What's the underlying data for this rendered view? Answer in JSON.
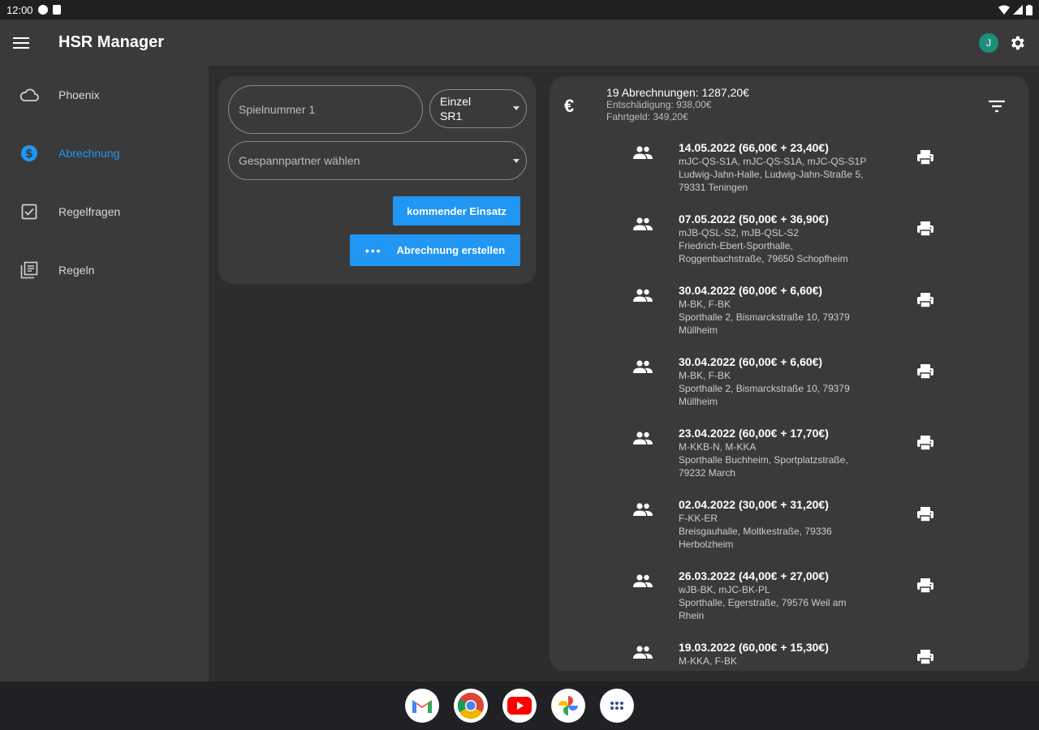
{
  "status": {
    "time": "12:00"
  },
  "appbar": {
    "title": "HSR Manager",
    "avatar_letter": "J"
  },
  "sidebar": {
    "items": [
      {
        "label": "Phoenix",
        "icon": "cloud-icon"
      },
      {
        "label": "Abrechnung",
        "icon": "dollar-icon"
      },
      {
        "label": "Regelfragen",
        "icon": "checkbox-icon"
      },
      {
        "label": "Regeln",
        "icon": "library-icon"
      }
    ]
  },
  "form": {
    "spielnummer_placeholder": "Spielnummer 1",
    "einzel_line1": "Einzel",
    "einzel_line2": "SR1",
    "gespann_placeholder": "Gespannpartner wählen",
    "kommend_label": "kommender Einsatz",
    "erstellen_dots": "•••",
    "erstellen_label": "Abrechnung erstellen"
  },
  "summary": {
    "title": "19 Abrechnungen: 1287,20€",
    "entschaedigung": "Entschädigung: 938,00€",
    "fahrtgeld": "Fahrtgeld: 349,20€"
  },
  "entries": [
    {
      "title": "14.05.2022 (66,00€ + 23,40€)",
      "lines": [
        "mJC-QS-S1A, mJC-QS-S1A, mJC-QS-S1P",
        "Ludwig-Jahn-Halle, Ludwig-Jahn-Straße 5,",
        "79331 Teningen"
      ]
    },
    {
      "title": "07.05.2022 (50,00€ + 36,90€)",
      "lines": [
        "mJB-QSL-S2, mJB-QSL-S2",
        "Friedrich-Ebert-Sporthalle,",
        "Roggenbachstraße, 79650 Schopfheim"
      ]
    },
    {
      "title": "30.04.2022 (60,00€ + 6,60€)",
      "lines": [
        "M-BK, F-BK",
        "Sporthalle 2, Bismarckstraße 10, 79379",
        "Müllheim"
      ]
    },
    {
      "title": "30.04.2022 (60,00€ + 6,60€)",
      "lines": [
        "M-BK, F-BK",
        "Sporthalle 2, Bismarckstraße 10, 79379",
        "Müllheim"
      ]
    },
    {
      "title": "23.04.2022 (60,00€ + 17,70€)",
      "lines": [
        "M-KKB-N, M-KKA",
        "Sporthalle Buchheim, Sportplatzstraße,",
        "79232 March"
      ]
    },
    {
      "title": "02.04.2022 (30,00€ + 31,20€)",
      "lines": [
        "F-KK-ER",
        "Breisgauhalle, Moltkestraße, 79336",
        "Herbolzheim"
      ]
    },
    {
      "title": "26.03.2022 (44,00€ + 27,00€)",
      "lines": [
        "wJB-BK, mJC-BK-PL",
        "Sporthalle, Egerstraße, 79576 Weil am",
        "Rhein"
      ]
    },
    {
      "title": "19.03.2022 (60,00€ + 15,30€)",
      "lines": [
        "M-KKA, F-BK",
        "",
        ""
      ]
    }
  ],
  "dock": [
    "gmail-icon",
    "chrome-icon",
    "youtube-icon",
    "photos-icon",
    "apps-icon"
  ]
}
